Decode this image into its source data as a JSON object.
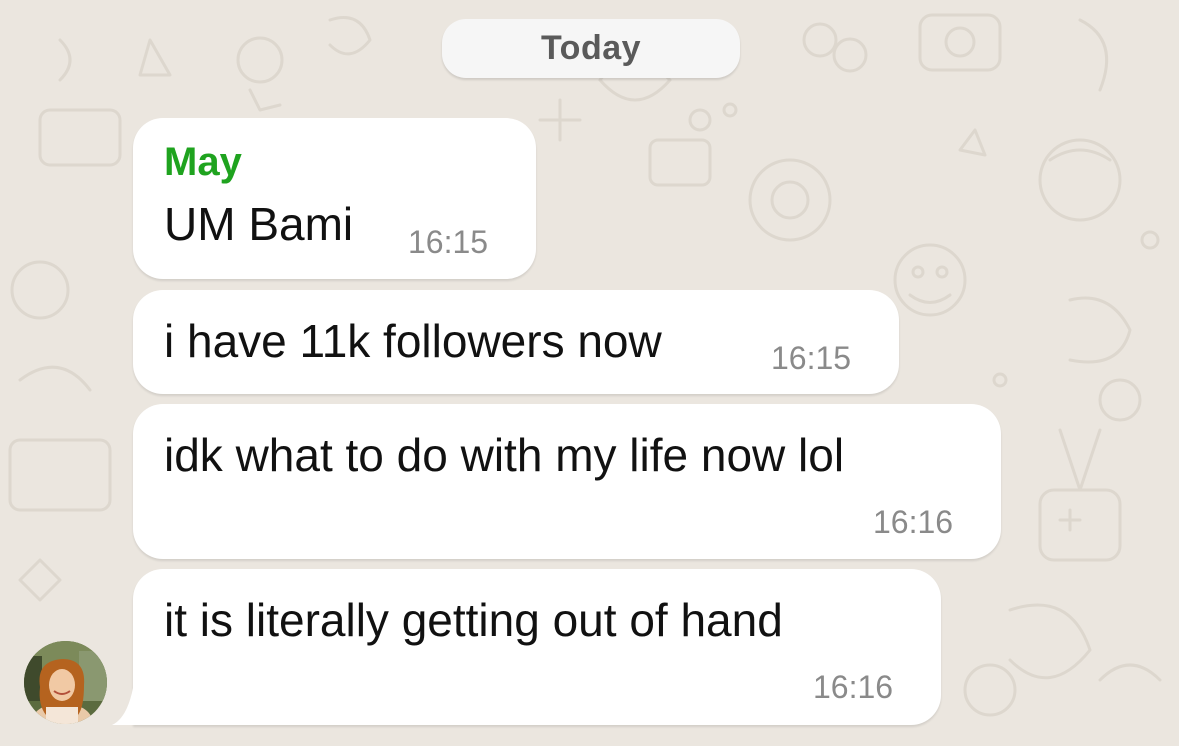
{
  "chat": {
    "date_label": "Today",
    "messages": [
      {
        "sender": "May",
        "text": "UM Bami",
        "time": "16:15"
      },
      {
        "text": "i have 11k followers now",
        "time": "16:15"
      },
      {
        "text": "idk what to do with my life now lol",
        "time": "16:16"
      },
      {
        "text": "it is literally getting out of hand",
        "time": "16:16"
      }
    ]
  },
  "colors": {
    "background": "#ebe6df",
    "bubble": "#ffffff",
    "sender_name": "#1fa31f",
    "timestamp": "#8a8a8a"
  },
  "icons": [
    "sender-avatar"
  ]
}
